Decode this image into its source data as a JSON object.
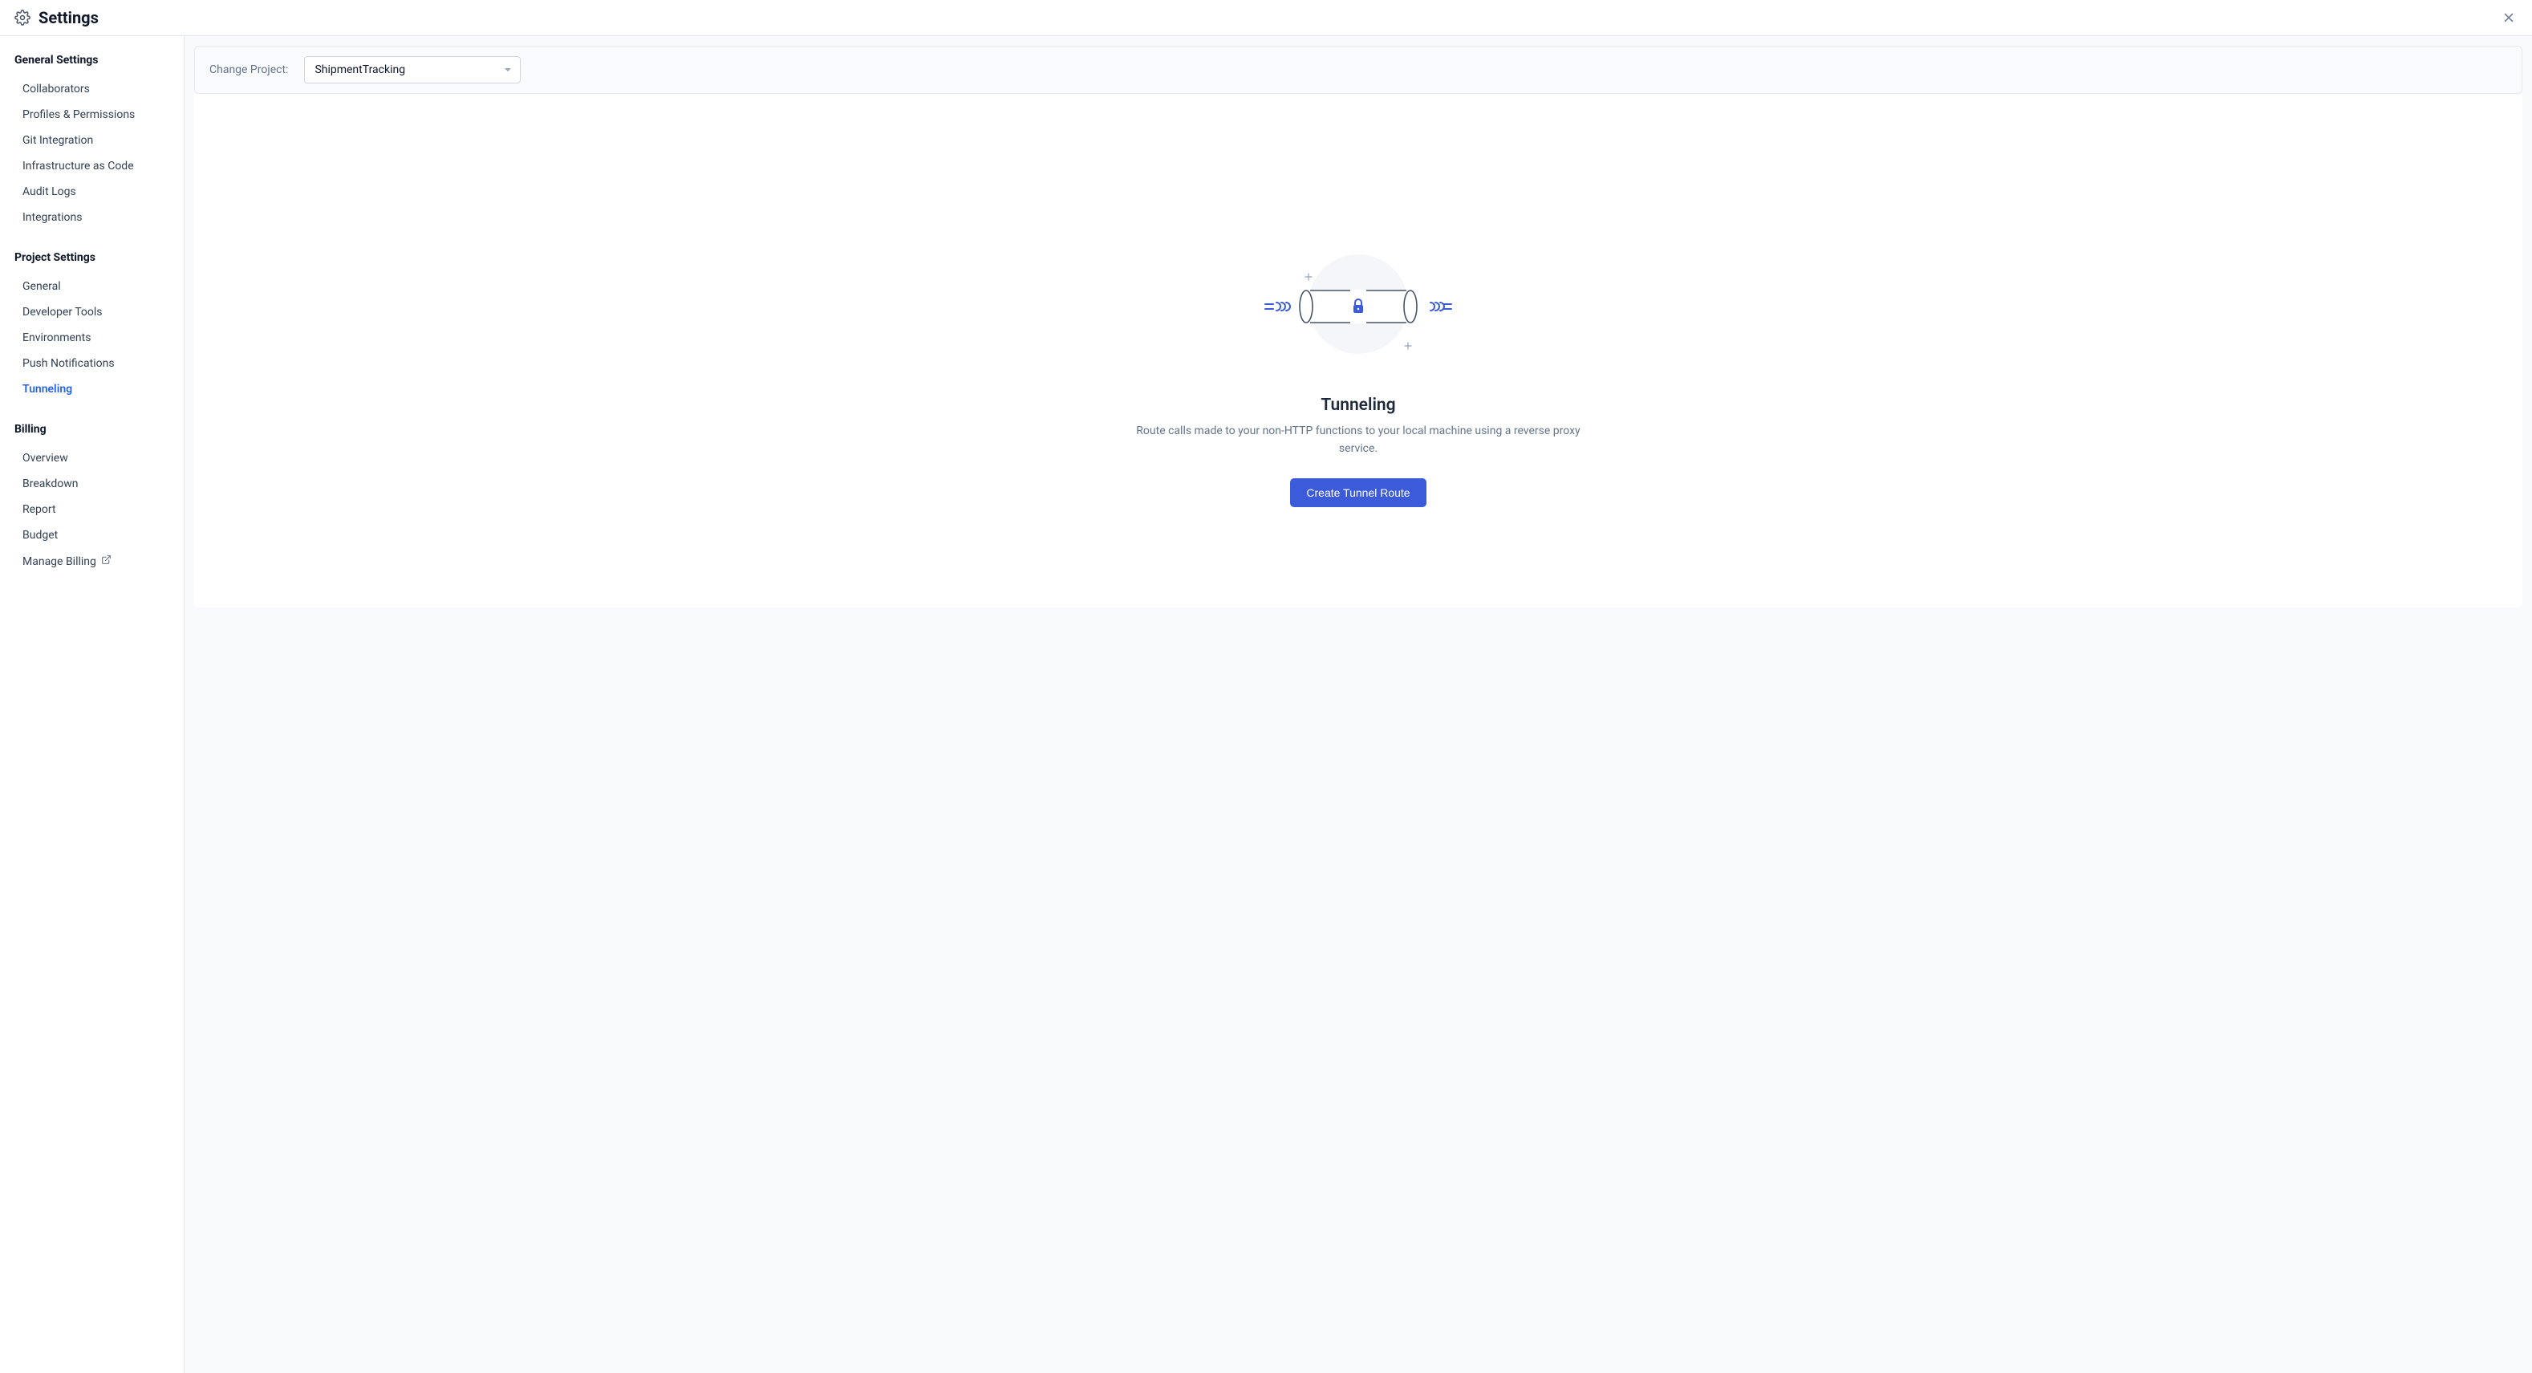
{
  "header": {
    "title": "Settings"
  },
  "sidebar": {
    "sections": [
      {
        "title": "General Settings",
        "items": [
          {
            "label": "Collaborators",
            "active": false,
            "external": false
          },
          {
            "label": "Profiles & Permissions",
            "active": false,
            "external": false
          },
          {
            "label": "Git Integration",
            "active": false,
            "external": false
          },
          {
            "label": "Infrastructure as Code",
            "active": false,
            "external": false
          },
          {
            "label": "Audit Logs",
            "active": false,
            "external": false
          },
          {
            "label": "Integrations",
            "active": false,
            "external": false
          }
        ]
      },
      {
        "title": "Project Settings",
        "items": [
          {
            "label": "General",
            "active": false,
            "external": false
          },
          {
            "label": "Developer Tools",
            "active": false,
            "external": false
          },
          {
            "label": "Environments",
            "active": false,
            "external": false
          },
          {
            "label": "Push Notifications",
            "active": false,
            "external": false
          },
          {
            "label": "Tunneling",
            "active": true,
            "external": false
          }
        ]
      },
      {
        "title": "Billing",
        "items": [
          {
            "label": "Overview",
            "active": false,
            "external": false
          },
          {
            "label": "Breakdown",
            "active": false,
            "external": false
          },
          {
            "label": "Report",
            "active": false,
            "external": false
          },
          {
            "label": "Budget",
            "active": false,
            "external": false
          },
          {
            "label": "Manage Billing",
            "active": false,
            "external": true
          }
        ]
      }
    ]
  },
  "project_bar": {
    "label": "Change Project:",
    "selected": "ShipmentTracking"
  },
  "main": {
    "title": "Tunneling",
    "description": "Route calls made to your non-HTTP functions to your local machine using a reverse proxy service.",
    "cta_label": "Create Tunnel Route"
  }
}
